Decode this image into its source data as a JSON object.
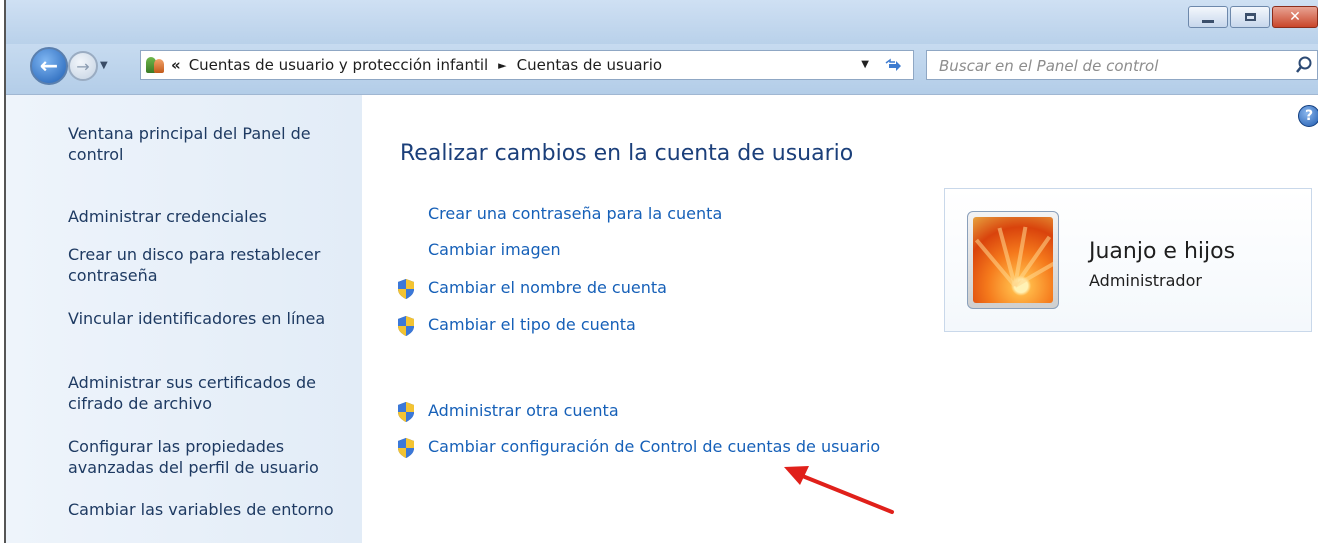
{
  "window": {
    "minimize_label": "",
    "maximize_label": "",
    "close_label": "✕"
  },
  "nav": {
    "back_glyph": "←",
    "forward_glyph": "→",
    "history_glyph": "▼"
  },
  "address": {
    "prefix": "«",
    "breadcrumbs": [
      "Cuentas de usuario y protección infantil",
      "Cuentas de usuario"
    ],
    "separator": "►",
    "dropdown_glyph": "▼",
    "refresh_glyph": "↻"
  },
  "search": {
    "placeholder": "Buscar en el Panel de control"
  },
  "sidebar": {
    "items": [
      {
        "label": "Ventana principal del Panel de control"
      },
      {
        "label": "Administrar credenciales"
      },
      {
        "label": "Crear un disco para restablecer contraseña"
      },
      {
        "label": "Vincular identificadores en línea"
      },
      {
        "label": "Administrar sus certificados de cifrado de archivo"
      },
      {
        "label": "Configurar las propiedades avanzadas del perfil de usuario"
      },
      {
        "label": "Cambiar las variables de entorno"
      }
    ]
  },
  "main": {
    "help_glyph": "?",
    "title": "Realizar cambios en la cuenta de usuario",
    "tasks": [
      {
        "label": "Crear una contraseña para la cuenta",
        "shield": false
      },
      {
        "label": "Cambiar imagen",
        "shield": false
      },
      {
        "label": "Cambiar el nombre de cuenta",
        "shield": true
      },
      {
        "label": "Cambiar el tipo de cuenta",
        "shield": true
      },
      {
        "label": "Administrar otra cuenta",
        "shield": true
      },
      {
        "label": "Cambiar configuración de Control de cuentas de usuario",
        "shield": true
      }
    ]
  },
  "account": {
    "name": "Juanjo e hijos",
    "role": "Administrador"
  },
  "colors": {
    "link": "#1660b8",
    "title": "#1b3f7a",
    "annotation_arrow": "#e0201a"
  },
  "icons": [
    "back-arrow-icon",
    "forward-arrow-icon",
    "user-accounts-icon",
    "refresh-icon",
    "search-icon",
    "help-icon",
    "uac-shield-icon",
    "red-annotation-arrow"
  ]
}
